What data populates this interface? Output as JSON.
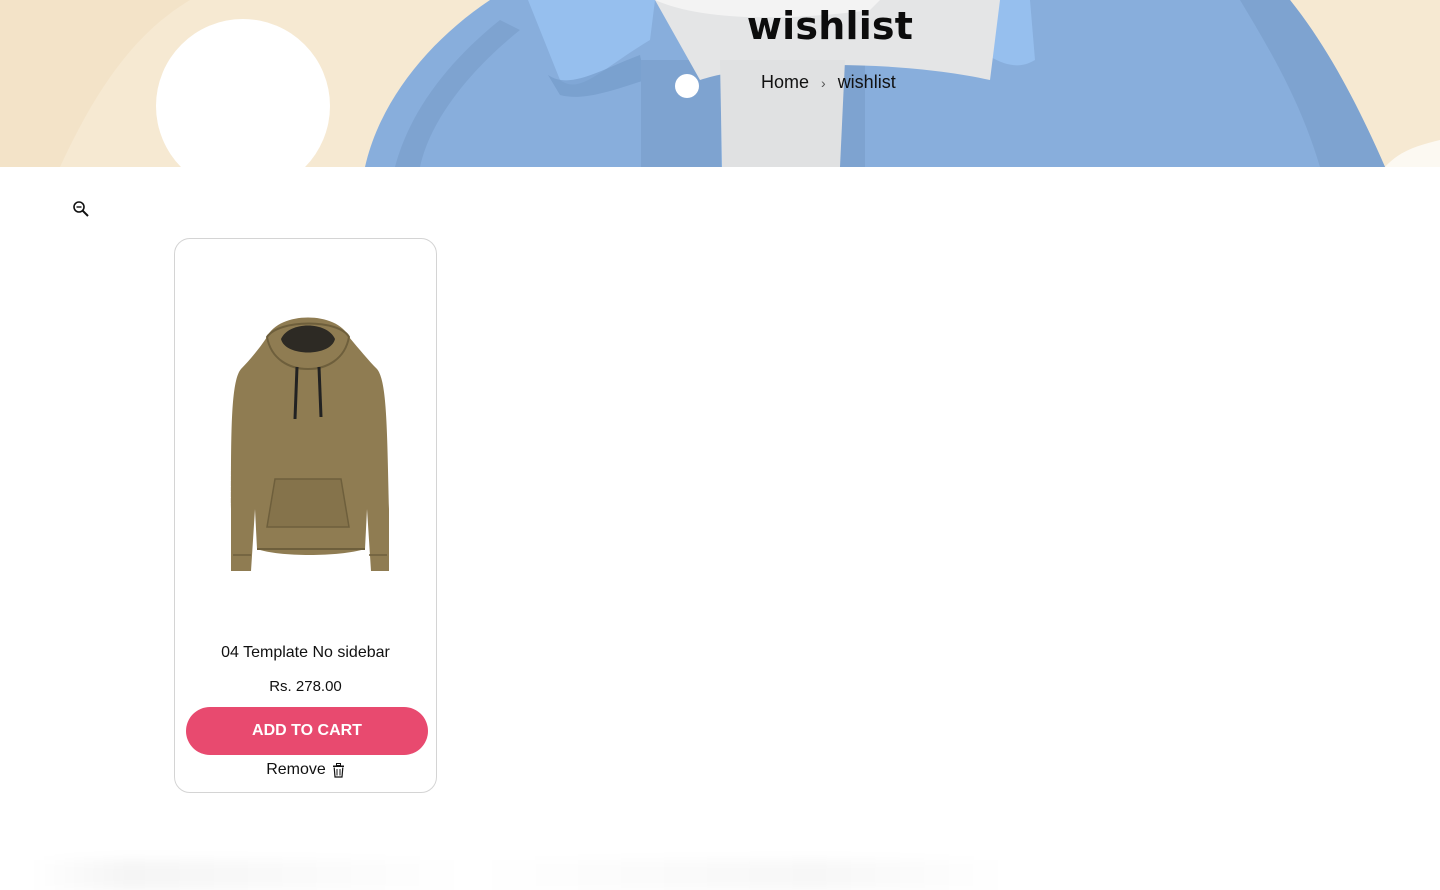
{
  "banner": {
    "title": "wishlist",
    "breadcrumb": {
      "home": "Home",
      "separator": "›",
      "current": "wishlist"
    }
  },
  "toolbar": {
    "zoom_icon": "zoom-out-icon"
  },
  "wishlist": {
    "items": [
      {
        "title": "04 Template No sidebar",
        "price": "Rs. 278.00",
        "add_to_cart_label": "ADD TO CART",
        "remove_label": "Remove",
        "remove_icon": "trash-icon",
        "image": "hoodie-image"
      }
    ]
  },
  "colors": {
    "banner_bg": "#f6e9d2",
    "shirt_blue": "#88aedc",
    "accent": "#e84a6f"
  }
}
